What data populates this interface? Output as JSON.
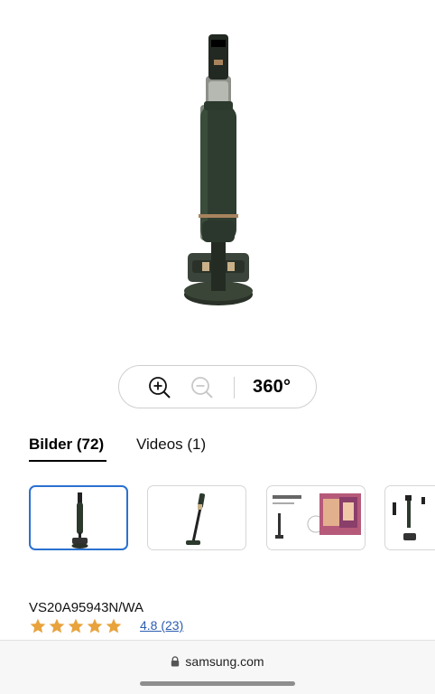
{
  "zoom_controls": {
    "zoom_in_icon": "zoom-in-icon",
    "zoom_out_icon": "zoom-out-icon",
    "view_360_label": "360°"
  },
  "tabs": [
    {
      "label": "Bilder (72)",
      "active": true
    },
    {
      "label": "Videos (1)",
      "active": false
    }
  ],
  "product": {
    "model": "VS20A95943N/WA",
    "rating_value": "4.8",
    "review_count": "(23)",
    "stars": 5,
    "star_color": "#e8a33d"
  },
  "browser": {
    "domain": "samsung.com",
    "lock_icon": "lock-icon"
  },
  "colors": {
    "accent": "#2a71d0",
    "product_green": "#2c3a2e"
  }
}
